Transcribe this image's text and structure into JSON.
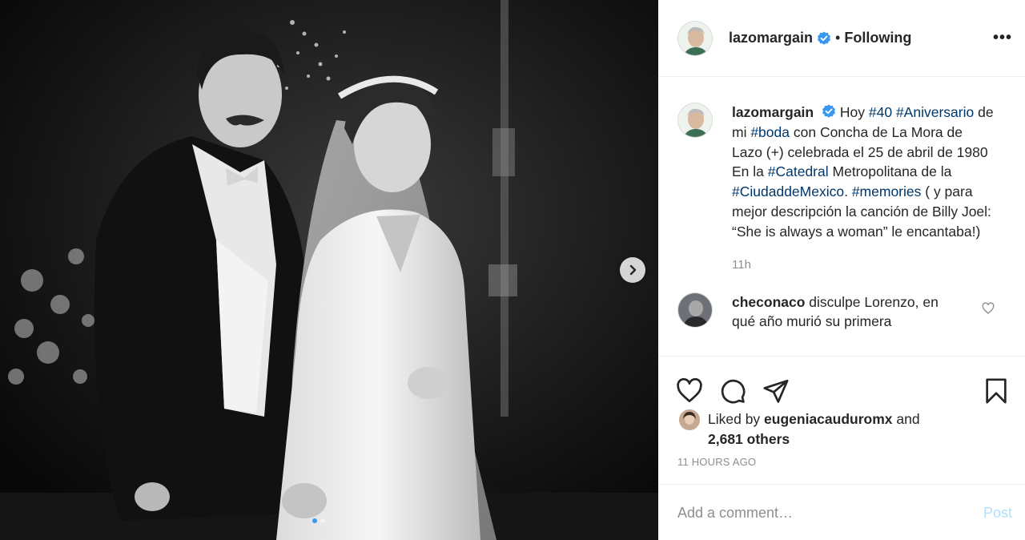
{
  "post": {
    "username": "lazomargain",
    "separator": "•",
    "following_label": "Following",
    "more_label": "•••",
    "photo_alt": "Black and white wedding photograph"
  },
  "caption": {
    "username": "lazomargain",
    "parts": [
      {
        "text": " Hoy ",
        "tag": false
      },
      {
        "text": "#40",
        "tag": true
      },
      {
        "text": " ",
        "tag": false
      },
      {
        "text": "#Aniversario",
        "tag": true
      },
      {
        "text": " de mi ",
        "tag": false
      },
      {
        "text": "#boda",
        "tag": true
      },
      {
        "text": " con Concha de La Mora de Lazo (+) celebrada el 25 de abril de 1980 En la ",
        "tag": false
      },
      {
        "text": "#Catedral",
        "tag": true
      },
      {
        "text": " Metropolitana de la ",
        "tag": false
      },
      {
        "text": "#CiudaddeMexico",
        "tag": true
      },
      {
        "text": ". ",
        "tag": false
      },
      {
        "text": "#memories",
        "tag": true
      },
      {
        "text": " ( y para mejor descripción la canción de Billy Joel: “She is always a woman” le encantaba!)",
        "tag": false
      }
    ],
    "time": "11h"
  },
  "comments": [
    {
      "username": "checonaco",
      "text": " disculpe Lorenzo, en qué año murió su primera"
    }
  ],
  "likes": {
    "prefix": "Liked by ",
    "username": "eugeniacauduromx",
    "middle": " and",
    "others": "2,681 others"
  },
  "timestamp": "11 HOURS AGO",
  "comment_input": {
    "placeholder": "Add a comment…",
    "post_label": "Post"
  },
  "colors": {
    "hashtag": "#00376b",
    "verified": "#3897f0",
    "post_button_disabled": "#b2dffc"
  }
}
